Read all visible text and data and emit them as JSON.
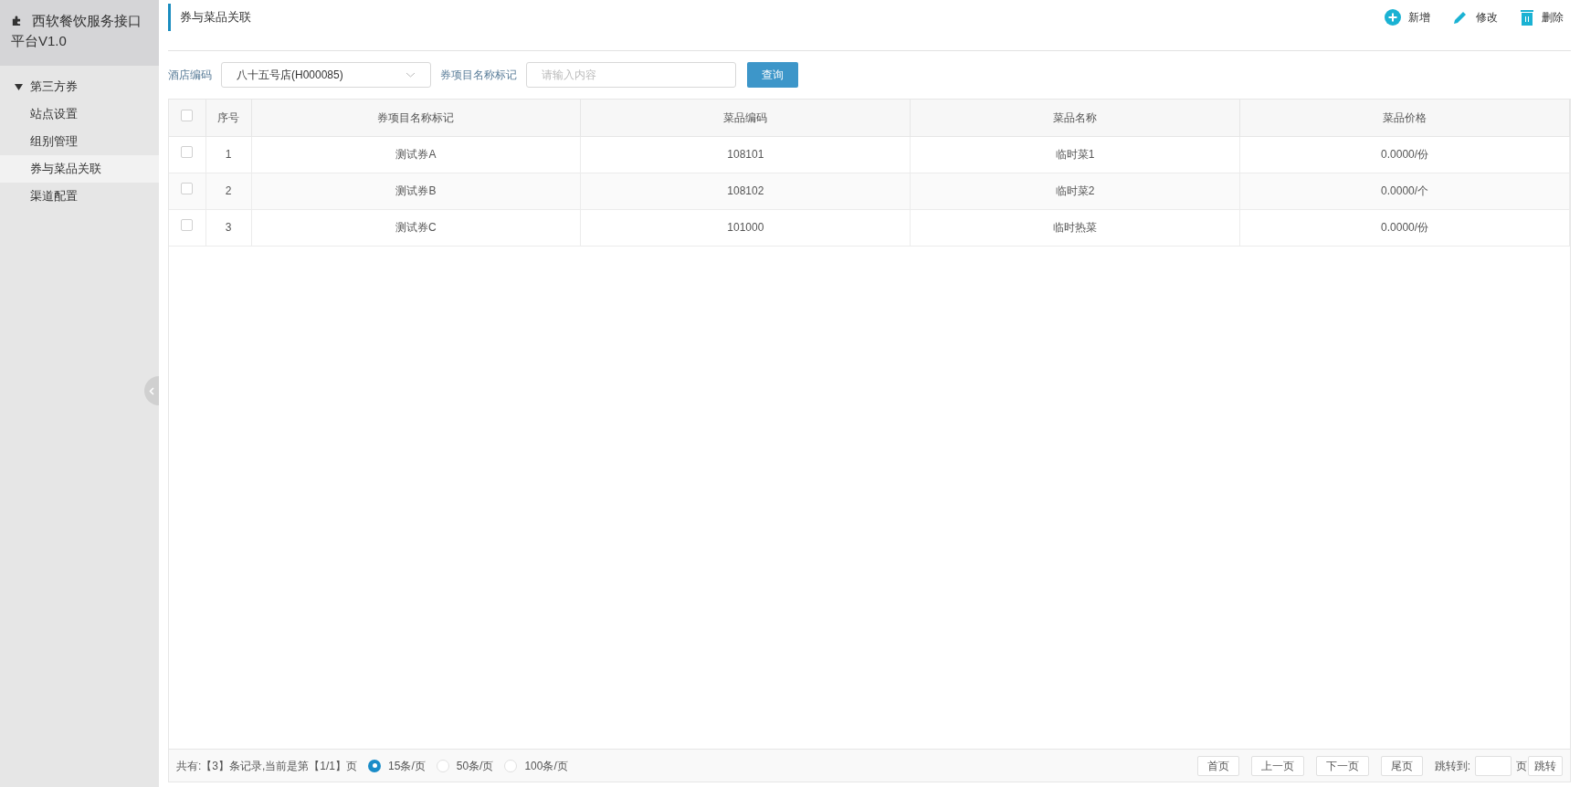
{
  "app_title": "西软餐饮服务接口平台V1.0",
  "sidebar": {
    "groups": [
      {
        "label": "第三方券",
        "expanded": true,
        "children": [
          {
            "label": "站点设置",
            "selected": false
          },
          {
            "label": "组别管理",
            "selected": false
          },
          {
            "label": "券与菜品关联",
            "selected": true
          },
          {
            "label": "渠道配置",
            "selected": false
          }
        ]
      }
    ]
  },
  "page_title": "券与菜品关联",
  "toolbar": [
    {
      "kind": "add",
      "label": "新增"
    },
    {
      "kind": "edit",
      "label": "修改"
    },
    {
      "kind": "delete",
      "label": "删除"
    }
  ],
  "filters": {
    "hotel_label": "酒店编码",
    "hotel_value": "八十五号店(H000085)",
    "coupon_label": "券项目名称标记",
    "coupon_placeholder": "请输入内容",
    "query_button": "查询"
  },
  "table": {
    "all_checked": false,
    "columns": [
      "序号",
      "券项目名称标记",
      "菜品编码",
      "菜品名称",
      "菜品价格"
    ],
    "rows": [
      {
        "checked": false,
        "cells": [
          "1",
          "测试券A",
          "108101",
          "临时菜1",
          "0.0000/份"
        ]
      },
      {
        "checked": false,
        "cells": [
          "2",
          "测试券B",
          "108102",
          "临时菜2",
          "0.0000/个"
        ]
      },
      {
        "checked": false,
        "cells": [
          "3",
          "测试券C",
          "101000",
          "临时热菜",
          "0.0000/份"
        ]
      }
    ]
  },
  "pagination": {
    "summary": "共有:【3】条记录,当前是第【1/1】页",
    "page_sizes": [
      {
        "label": "15条/页",
        "selected": true
      },
      {
        "label": "50条/页",
        "selected": false
      },
      {
        "label": "100条/页",
        "selected": false
      }
    ],
    "buttons": [
      "首页",
      "上一页",
      "下一页",
      "尾页"
    ],
    "jump_label": "跳转到:",
    "jump_unit": "页",
    "jump_button": "跳转"
  }
}
